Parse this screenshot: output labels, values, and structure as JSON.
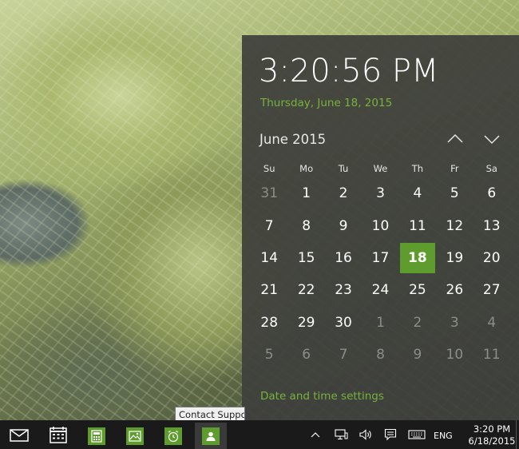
{
  "flyout": {
    "clock": "3:20:56 PM",
    "date_long": "Thursday, June 18, 2015",
    "month_title": "June 2015",
    "nav_up_icon": "chevron-up-icon",
    "nav_down_icon": "chevron-down-icon",
    "weekdays": [
      "Su",
      "Mo",
      "Tu",
      "We",
      "Th",
      "Fr",
      "Sa"
    ],
    "days": [
      {
        "label": "31",
        "state": "other-month"
      },
      {
        "label": "1",
        "state": "current"
      },
      {
        "label": "2",
        "state": "current"
      },
      {
        "label": "3",
        "state": "current"
      },
      {
        "label": "4",
        "state": "current"
      },
      {
        "label": "5",
        "state": "current"
      },
      {
        "label": "6",
        "state": "current"
      },
      {
        "label": "7",
        "state": "current"
      },
      {
        "label": "8",
        "state": "current"
      },
      {
        "label": "9",
        "state": "current"
      },
      {
        "label": "10",
        "state": "current"
      },
      {
        "label": "11",
        "state": "current"
      },
      {
        "label": "12",
        "state": "current"
      },
      {
        "label": "13",
        "state": "current"
      },
      {
        "label": "14",
        "state": "current"
      },
      {
        "label": "15",
        "state": "current"
      },
      {
        "label": "16",
        "state": "current"
      },
      {
        "label": "17",
        "state": "current"
      },
      {
        "label": "18",
        "state": "today"
      },
      {
        "label": "19",
        "state": "current"
      },
      {
        "label": "20",
        "state": "current"
      },
      {
        "label": "21",
        "state": "current"
      },
      {
        "label": "22",
        "state": "current"
      },
      {
        "label": "23",
        "state": "current"
      },
      {
        "label": "24",
        "state": "current"
      },
      {
        "label": "25",
        "state": "current"
      },
      {
        "label": "26",
        "state": "current"
      },
      {
        "label": "27",
        "state": "current"
      },
      {
        "label": "28",
        "state": "current"
      },
      {
        "label": "29",
        "state": "current"
      },
      {
        "label": "30",
        "state": "current"
      },
      {
        "label": "1",
        "state": "other-month"
      },
      {
        "label": "2",
        "state": "other-month"
      },
      {
        "label": "3",
        "state": "other-month"
      },
      {
        "label": "4",
        "state": "other-month"
      },
      {
        "label": "5",
        "state": "other-month"
      },
      {
        "label": "6",
        "state": "other-month"
      },
      {
        "label": "7",
        "state": "other-month"
      },
      {
        "label": "8",
        "state": "other-month"
      },
      {
        "label": "9",
        "state": "other-month"
      },
      {
        "label": "10",
        "state": "other-month"
      },
      {
        "label": "11",
        "state": "other-month"
      }
    ],
    "settings_link": "Date and time settings"
  },
  "tooltip": {
    "text": "Contact Support"
  },
  "taskbar": {
    "apps": [
      {
        "name": "mail",
        "icon": "mail-icon"
      },
      {
        "name": "calendar",
        "icon": "calendar-icon"
      },
      {
        "name": "calculator",
        "icon": "calculator-icon"
      },
      {
        "name": "photos",
        "icon": "photos-icon"
      },
      {
        "name": "alarms",
        "icon": "alarm-clock-icon"
      },
      {
        "name": "contact-support",
        "icon": "contact-support-icon"
      }
    ],
    "tray": {
      "overflow_icon": "chevron-up-icon",
      "network_icon": "network-icon",
      "volume_icon": "volume-icon",
      "action_center_icon": "action-center-icon",
      "keyboard_icon": "touch-keyboard-icon",
      "language": "ENG",
      "time": "3:20 PM",
      "date": "6/18/2015"
    }
  },
  "colors": {
    "accent": "#5f9c2e",
    "accent_text": "#76b33c",
    "flyout_bg": "#3e403c",
    "taskbar_bg": "#1a1a1a"
  }
}
